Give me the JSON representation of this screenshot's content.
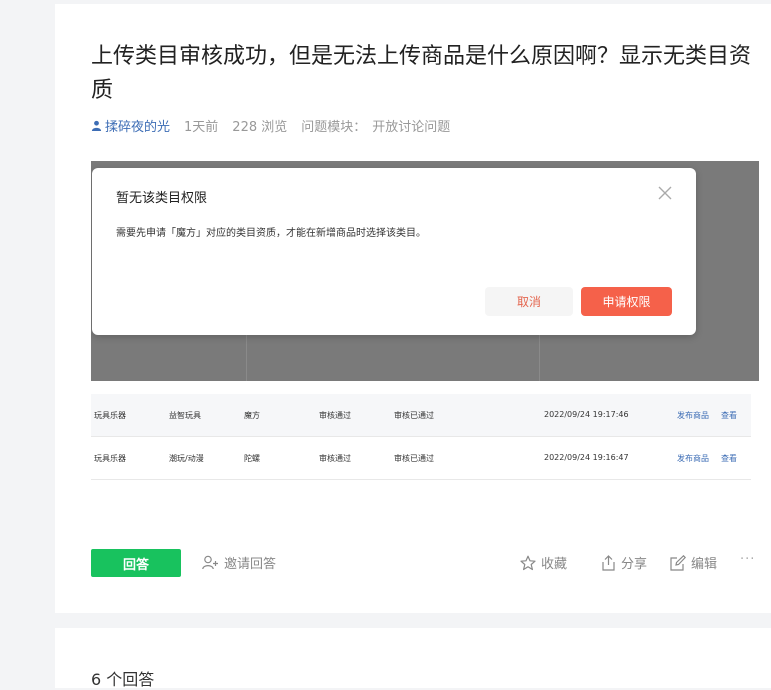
{
  "question": {
    "title": "上传类目审核成功，但是无法上传商品是什么原因啊？显示无类目资质",
    "author": "揉碎夜的光",
    "time": "1天前",
    "views": "228 浏览",
    "module_label": "问题模块：",
    "module_value": "开放讨论问题"
  },
  "screenshot": {
    "dialog": {
      "title": "暂无该类目权限",
      "message": "需要先申请「魔方」对应的类目资质，才能在新增商品时选择该类目。",
      "cancel_label": "取消",
      "apply_label": "申请权限"
    },
    "rows": [
      {
        "category": "玩具乐器",
        "sub": "益智玩具",
        "leaf": "魔方",
        "status1": "审核通过",
        "status2": "审核已通过",
        "time": "2022/09/24 19:17:46",
        "action1": "发布商品",
        "action2": "查看"
      },
      {
        "category": "玩具乐器",
        "sub": "潮玩/动漫",
        "leaf": "陀螺",
        "status1": "审核通过",
        "status2": "审核已通过",
        "time": "2022/09/24 19:16:47",
        "action1": "发布商品",
        "action2": "查看"
      }
    ]
  },
  "actions": {
    "answer": "回答",
    "invite": "邀请回答",
    "collect": "收藏",
    "share": "分享",
    "edit": "编辑",
    "more": "···"
  },
  "answers": {
    "count_label": "6 个回答"
  },
  "colors": {
    "accent_green": "#18c25e",
    "apply_red": "#f5614a",
    "link_blue": "#3d6db5"
  }
}
